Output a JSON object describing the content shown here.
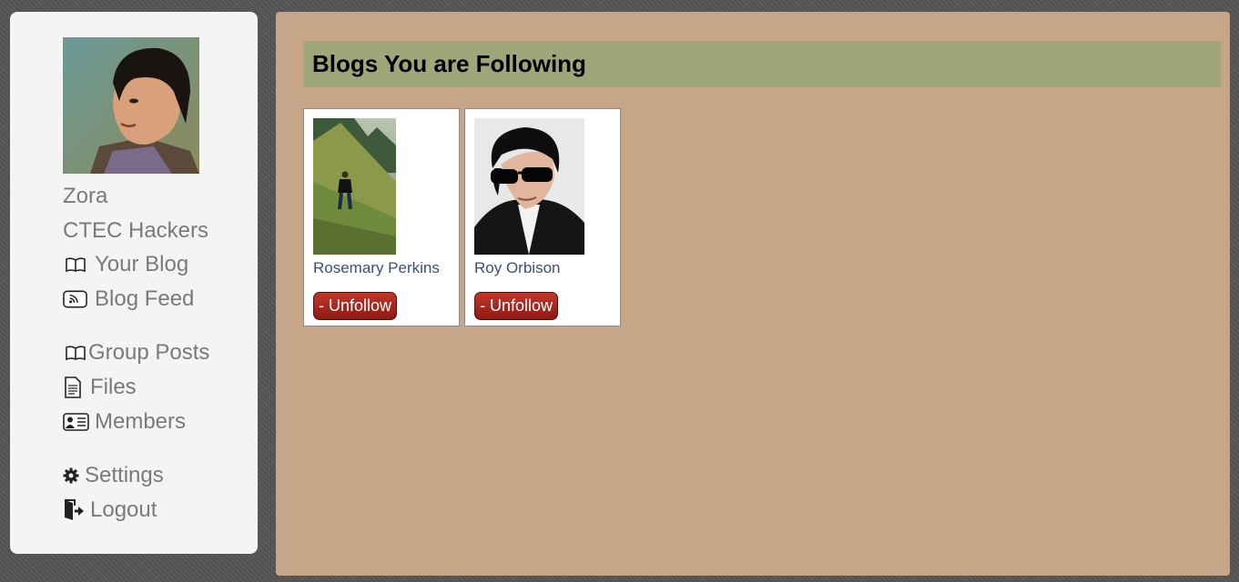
{
  "sidebar": {
    "user_name": "Zora",
    "group_name": "CTEC Hackers",
    "avatar_icon": "user-portrait",
    "items": [
      {
        "label": "Your Blog",
        "icon": "open-book-icon"
      },
      {
        "label": "Blog Feed",
        "icon": "rss-icon"
      },
      {
        "label": "Group Posts",
        "icon": "open-book-icon"
      },
      {
        "label": "Files",
        "icon": "document-icon"
      },
      {
        "label": "Members",
        "icon": "id-card-icon"
      },
      {
        "label": "Settings",
        "icon": "gear-icon"
      },
      {
        "label": "Logout",
        "icon": "logout-icon"
      }
    ]
  },
  "main": {
    "heading": "Blogs You are Following",
    "blogs": [
      {
        "name": "Rosemary Perkins",
        "button_label": "- Unfollow"
      },
      {
        "name": "Roy Orbison",
        "button_label": "- Unfollow"
      }
    ]
  },
  "colors": {
    "page_background": "#555555",
    "sidebar_background": "#f4f4f4",
    "main_background": "#c6a588",
    "heading_background": "#9ea779",
    "button_red": "#a92820",
    "link_color": "#3b4f7a"
  }
}
